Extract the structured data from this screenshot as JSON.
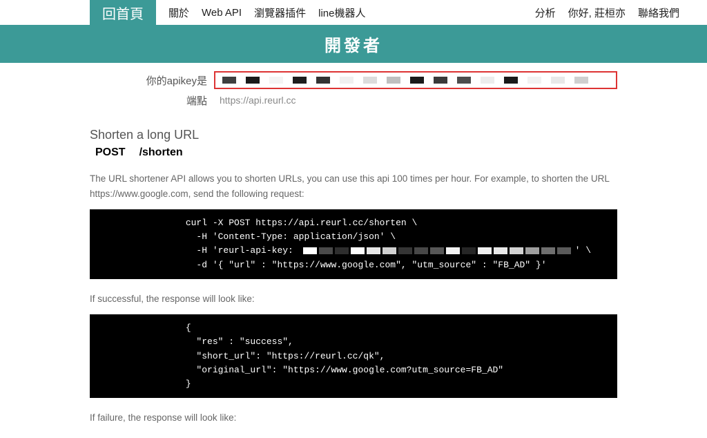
{
  "nav": {
    "home": "回首頁",
    "links": [
      "關於",
      "Web API",
      "瀏覽器插件",
      "line機器人"
    ],
    "right": [
      "分析",
      "你好, 莊桓亦",
      "聯絡我們"
    ]
  },
  "banner": "開發者",
  "info": {
    "apikey_label": "你的apikey是",
    "endpoint_label": "端點",
    "endpoint_value": "https://api.reurl.cc",
    "redact_shades": [
      "#3f3f3f",
      "#1a1a1a",
      "#f4f4f4",
      "#1e1e1e",
      "#333",
      "#f0f0f0",
      "#dcdcdc",
      "#bfbfbf",
      "#1a1a1a",
      "#3a3a3a",
      "#4d4d4d",
      "#ececec",
      "#1a1a1a",
      "#f2f2f2",
      "#e8e8e8",
      "#cfcfcf"
    ]
  },
  "shorten": {
    "title": "Shorten a long URL",
    "method": "POST",
    "path": "/shorten",
    "desc": "The URL shortener API allows you to shorten URLs, you can use this api 100 times per hour. For example, to shorten the URL https://www.google.com, send the following request:",
    "code_pref": "                curl -X POST https://api.reurl.cc/shorten \\\n                  -H 'Content-Type: application/json' \\\n                  -H 'reurl-api-key: ",
    "code_suffix": "' \\\n                  -d '{ \"url\" : \"https://www.google.com\", \"utm_source\" : \"FB_AD\" }'",
    "code_redact_shades": [
      "#fff",
      "#4a4a4a",
      "#2e2e2e",
      "#fdfdfd",
      "#e6e6e6",
      "#d0d0d0",
      "#353535",
      "#474747",
      "#575757",
      "#f2f2f2",
      "#262626",
      "#f0f0f0",
      "#e8e8e8",
      "#d2d2d2",
      "#9e9e9e",
      "#6f6f6f",
      "#5a5a5a"
    ]
  },
  "success": {
    "label": "If successful, the response will look like:",
    "code": "                {\n                  \"res\" : \"success\",\n                  \"short_url\": \"https://reurl.cc/qk\",\n                  \"original_url\": \"https://www.google.com?utm_source=FB_AD\"\n                }"
  },
  "failure": {
    "label": "If failure, the response will look like:"
  }
}
